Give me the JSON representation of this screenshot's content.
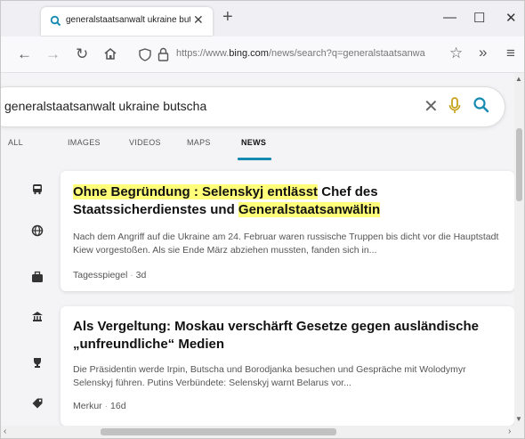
{
  "browser": {
    "tab_title": "generalstaatsanwalt ukraine but",
    "tab_close": "✕",
    "new_tab": "+",
    "minimize": "—",
    "maximize": "☐",
    "close": "✕",
    "url_prefix": "https://www.",
    "url_domain": "bing.com",
    "url_path": "/news/search?q=generalstaatsanwa",
    "icons": [
      "back-icon",
      "forward-icon",
      "reload-icon",
      "home-icon",
      "shield-icon",
      "lock-icon",
      "star-icon",
      "overflow-icon",
      "menu-icon"
    ]
  },
  "search": {
    "query": "generalstaatsanwalt ukraine butscha",
    "clear": "✕"
  },
  "tabs": [
    "ALL",
    "IMAGES",
    "VIDEOS",
    "MAPS",
    "NEWS"
  ],
  "active_tab": "NEWS",
  "results": [
    {
      "headline_parts": [
        {
          "text": "Ohne Begründung : Selenskyj entlässt",
          "highlight": true
        },
        {
          "text": " Chef des Staatssicherdienstes und ",
          "highlight": false
        },
        {
          "text": "Generalstaatsanwältin",
          "highlight": true
        }
      ],
      "snippet": "Nach dem Angriff auf die Ukraine am 24. Februar waren russische Truppen bis dicht vor die Hauptstadt Kiew vorgestoßen. Als sie Ende März abziehen mussten, fanden sich in...",
      "source": "Tagesspiegel",
      "age": "3d"
    },
    {
      "headline_parts": [
        {
          "text": "Als Vergeltung: Moskau verschärft Gesetze gegen ausländische „unfreundliche“ Medien",
          "highlight": false
        }
      ],
      "snippet": "Die Präsidentin werde Irpin, Butscha und Borodjanka besuchen und Gespräche mit Wolodymyr Selenskyj führen. Putins Verbündete: Selenskyj warnt Belarus vor...",
      "source": "Merkur",
      "age": "16d"
    }
  ],
  "colors": {
    "accent": "#178ab1",
    "highlight": "#ffff7a",
    "search_icon": "#178ab1",
    "mic_icon": "#c8a21a"
  }
}
